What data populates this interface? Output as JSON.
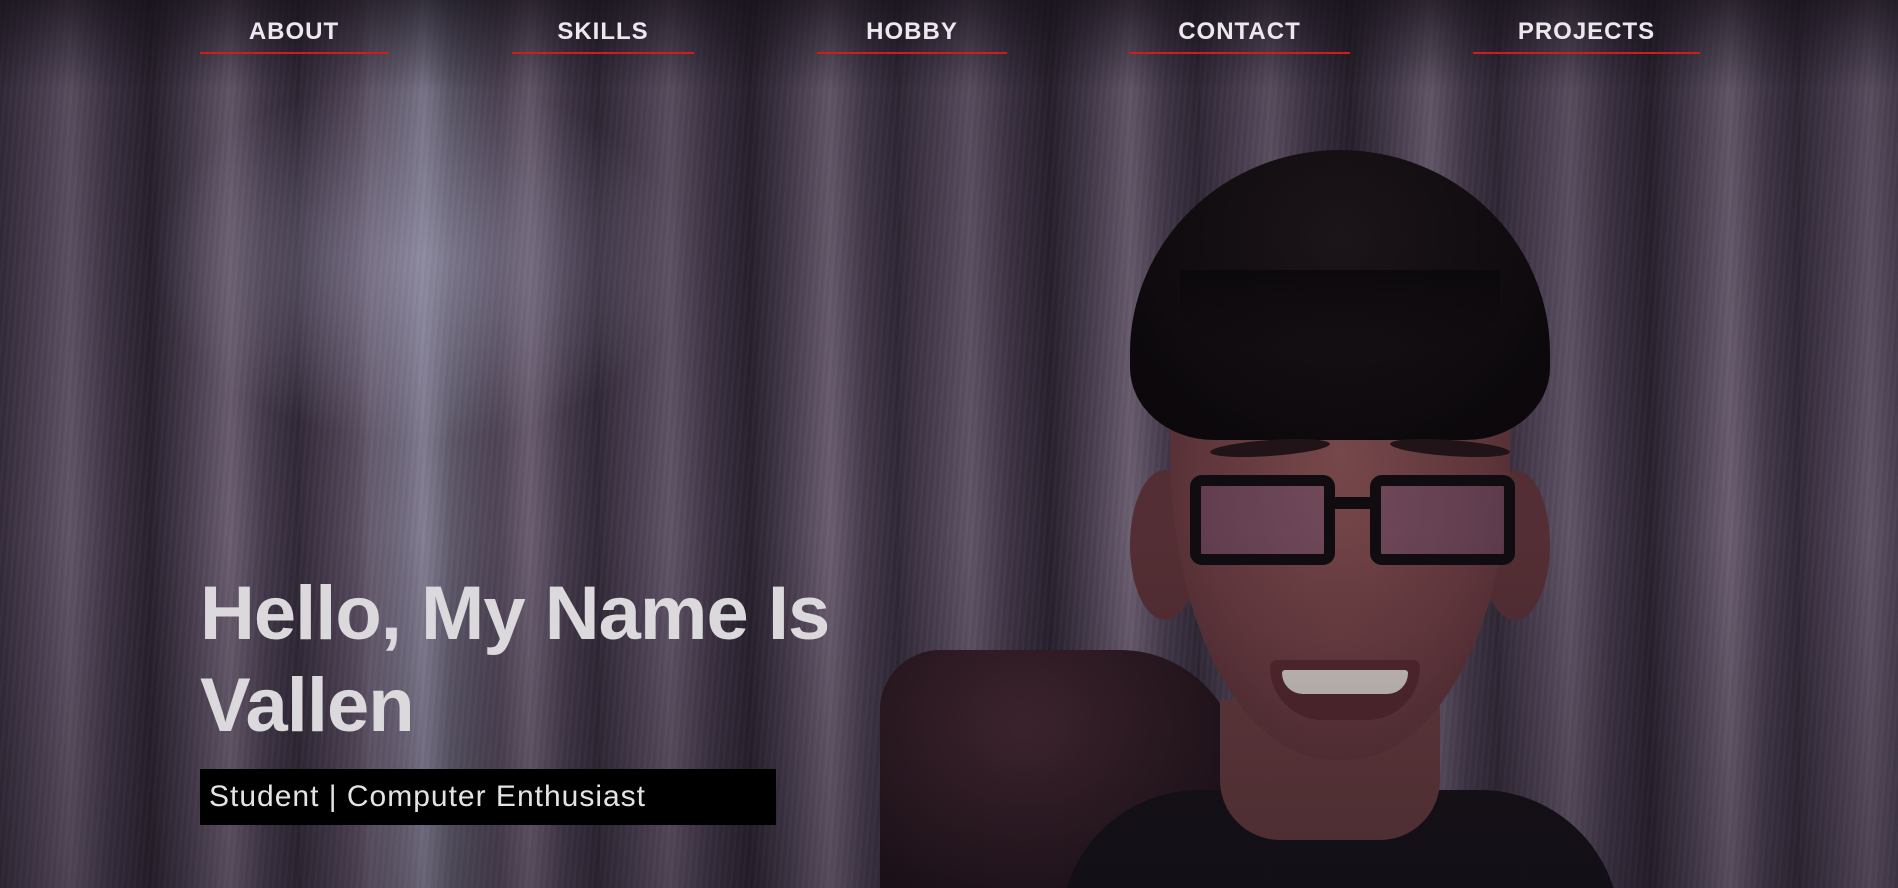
{
  "nav": {
    "items": [
      {
        "label": "ABOUT"
      },
      {
        "label": "SKILLS"
      },
      {
        "label": "HOBBY"
      },
      {
        "label": "CONTACT"
      },
      {
        "label": "PROJECTS"
      }
    ],
    "underline_color": "#d01c1c"
  },
  "hero": {
    "headline": "Hello, My Name Is Vallen",
    "tagline": "Student | Computer Enthusiast",
    "tagline_background": "#000000"
  }
}
